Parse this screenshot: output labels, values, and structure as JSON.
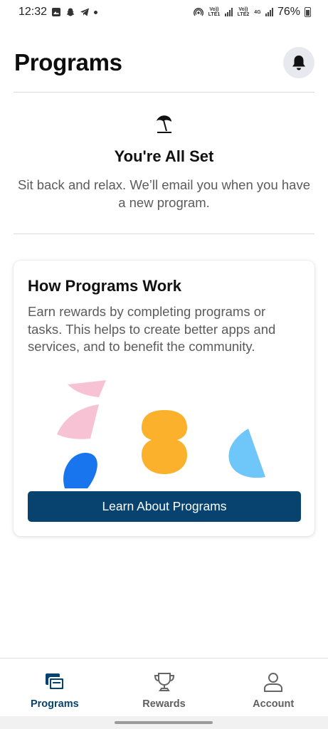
{
  "status_bar": {
    "time": "12:32",
    "sim1_label": "Vo)) LTE1",
    "sim2_label": "Vo)) LTE2",
    "network_4g": "4G",
    "battery": "76%"
  },
  "header": {
    "title": "Programs",
    "bell_icon": "bell-icon"
  },
  "all_set": {
    "icon": "beach-umbrella-icon",
    "title": "You're All Set",
    "message": "Sit back and relax. We’ll email you when you have a new program."
  },
  "card": {
    "title": "How Programs Work",
    "text": "Earn rewards by completing programs or tasks. This helps to create better apps and services, and to benefit the community.",
    "button_label": "Learn About Programs",
    "colors": {
      "pink": "#f8c2d5",
      "orange": "#fbb12b",
      "blue": "#1875ee",
      "light_blue": "#6fc6f8",
      "button": "#08426f"
    }
  },
  "bottom_nav": {
    "items": [
      {
        "label": "Programs",
        "icon": "programs-cards-icon",
        "active": true
      },
      {
        "label": "Rewards",
        "icon": "trophy-icon",
        "active": false
      },
      {
        "label": "Account",
        "icon": "person-icon",
        "active": false
      }
    ]
  }
}
